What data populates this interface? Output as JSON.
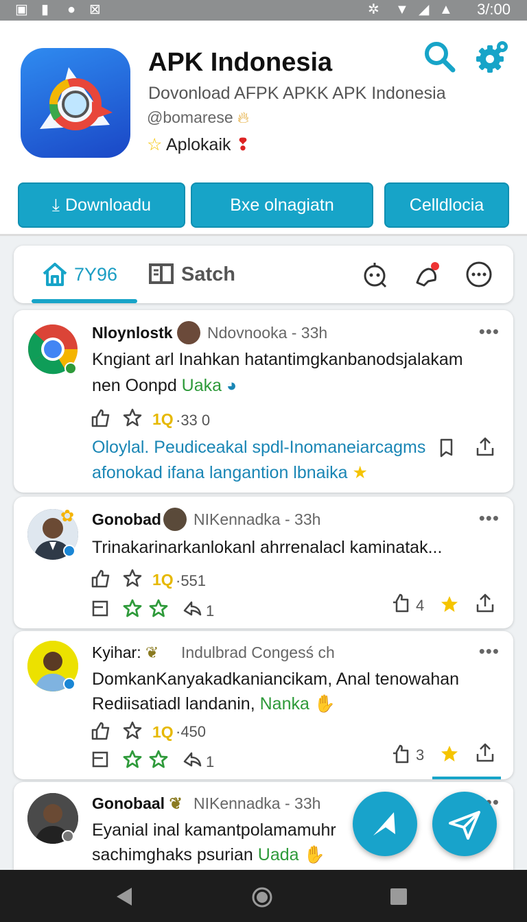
{
  "status_bar": {
    "time": "3/:00"
  },
  "app": {
    "title": "APK Indonesia",
    "subtitle": "Dovonload AFPK APKK APK Indonesia",
    "handle": "@bomarese",
    "category": "Aplokaik"
  },
  "actions": {
    "download": "Downloadu",
    "middle": "Bxe olnagiatn",
    "right": "Celldlocia"
  },
  "tabs": {
    "home_label": "7Y96",
    "search_label": "Satch"
  },
  "posts": [
    {
      "name": "Nloynlostk",
      "meta": "Ndovnooka - 33h",
      "line1": "Kngiant arl Inahkan hatantimgkanbanodsjalakam",
      "line2_prefix": "nen Oonpd ",
      "line2_highlight": "Uaka",
      "badge": "1Q",
      "count": "·33 0",
      "link_line1": "Oloylal. Peudiceakal spdl-Inomaneiarcagms",
      "link_line2": "afonokad ifana langantion lbnaika"
    },
    {
      "name": "Gonobad",
      "meta": "NIKennadka - 33h",
      "line1": "Trinakarinarkanlokanl ahrrenalacl kaminatak...",
      "badge": "1Q",
      "count": "·551",
      "reshares": "1",
      "likes": "4"
    },
    {
      "name": "Kyihar:",
      "meta": "Indulbrad Congesś ch",
      "line1": "DomkanKanyakadkaniancikam, Anal tenowahan",
      "line2_prefix": "Rediisatiadl landanin, ",
      "line2_highlight": "Nanka",
      "badge": "1Q",
      "count": "·450",
      "reshares": "1",
      "likes": "3"
    },
    {
      "name": "Gonobaal",
      "meta": "NIKennadka - 33h",
      "line1": "Eyanial inal kamantpolamamuhr",
      "line2_prefix": "sachimghaks psurian ",
      "line2_highlight": "Uada"
    }
  ],
  "colors": {
    "accent": "#17a4c8",
    "star": "#f5c400",
    "green": "#2e9a3a"
  }
}
